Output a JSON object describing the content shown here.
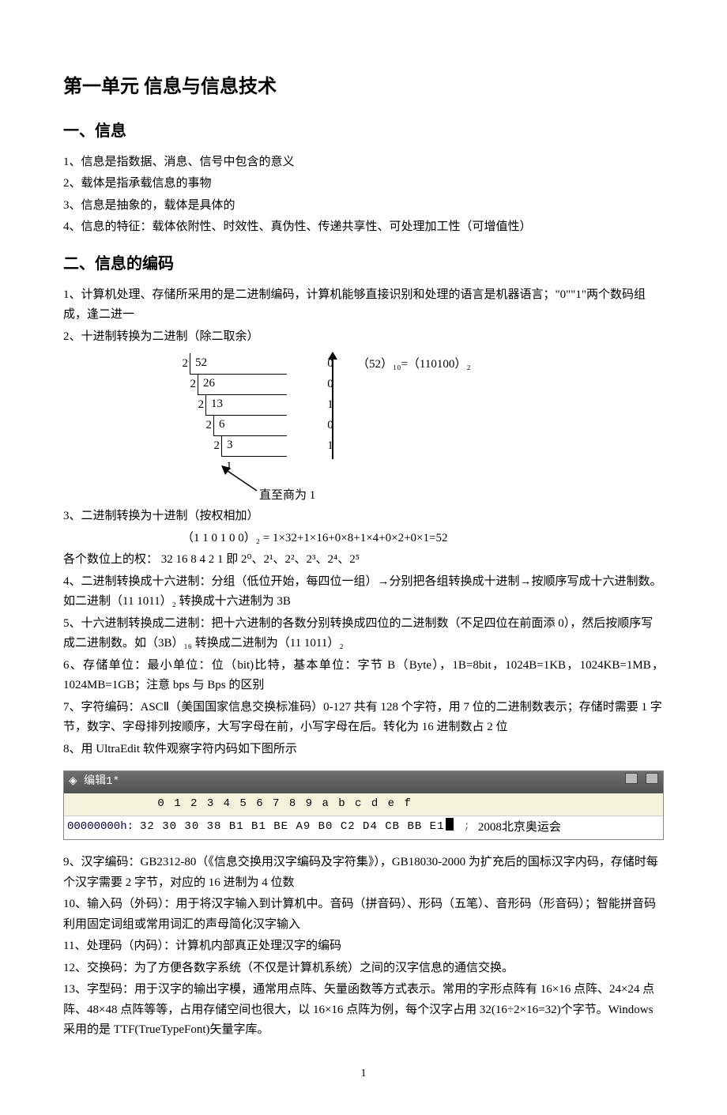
{
  "title": "第一单元 信息与信息技术",
  "sec1": {
    "heading": "一、信息",
    "p1": "1、信息是指数据、消息、信号中包含的意义",
    "p2": "2、载体是指承载信息的事物",
    "p3": "3、信息是抽象的，载体是具体的",
    "p4": "4、信息的特征：载体依附性、时效性、真伪性、传递共享性、可处理加工性（可增值性）"
  },
  "sec2": {
    "heading": "二、信息的编码",
    "p1": "1、计算机处理、存储所采用的是二进制编码，计算机能够直接识别和处理的语言是机器语言；\"0\"\"1\"两个数码组成，逢二进一",
    "p2": "2、十进制转换为二进制（除二取余）",
    "division": {
      "rows": [
        {
          "divisor": "2",
          "dividend": "52",
          "remainder": "0"
        },
        {
          "divisor": "2",
          "dividend": "26",
          "remainder": "0"
        },
        {
          "divisor": "2",
          "dividend": "13",
          "remainder": "1"
        },
        {
          "divisor": "2",
          "dividend": "6",
          "remainder": "0"
        },
        {
          "divisor": "2",
          "dividend": "3",
          "remainder": "1"
        }
      ],
      "final": "1",
      "note": "直至商为 1",
      "result": "（52）₁₀=（110100）₂"
    },
    "p3": "3、二进制转换为十进制（按权相加）",
    "eq": "（1   1    0   1   0   0）₂   =   1×32+1×16+0×8+1×4+0×2+0×1=52",
    "weights": "各个数位上的权：  32   16   8   4   2   1   即 2⁰、2¹、2²、2³、2⁴、2⁵",
    "p4": "4、二进制转换成十六进制：分组（低位开始，每四位一组）→分别把各组转换成十进制→按顺序写成十六进制数。如二进制（11 1011）₂ 转换成十六进制为 3B",
    "p5": "5、十六进制转换成二进制：把十六进制的各数分别转换成四位的二进制数（不足四位在前面添 0），然后按顺序写成二进制数。如（3B）₁₆ 转换成二进制为（11 1011）₂",
    "p6": "6、存储单位：最小单位：位（bit)比特，基本单位：字节 B（Byte），1B=8bit，1024B=1KB，1024KB=1MB，1024MB=1GB；注意 bps 与 Bps 的区别",
    "p7": "7、字符编码：ASCⅡ（美国国家信息交换标准码）0-127 共有 128 个字符，用 7 位的二进制数表示；存储时需要 1 字节，数字、字母排列按顺序，大写字母在前，小写字母在后。转化为 16 进制数占 2 位",
    "p8": "8、用 UltraEdit 软件观察字符内码如下图所示",
    "hex": {
      "title": "编辑1*",
      "ruler": "0  1  2  3  4  5  6  7  8  9  a  b  c  d  e  f",
      "offset": "00000000h:",
      "bytes": "32 30 30 38 B1 B1 BE A9 B0 C2 D4 CB BB E1",
      "sep": ";",
      "text": "2008北京奥运会"
    },
    "p9": "9、汉字编码：GB2312-80（《信息交换用汉字编码及字符集》），GB18030-2000 为扩充后的国标汉字内码，存储时每个汉字需要 2 字节，对应的 16 进制为 4 位数",
    "p10": "10、输入码（外码）：用于将汉字输入到计算机中。音码（拼音码）、形码（五笔）、音形码（形音码）；智能拼音码利用固定词组或常用词汇的声母简化汉字输入",
    "p11": "11、处理码（内码）：计算机内部真正处理汉字的编码",
    "p12": "12、交换码：为了方便各数字系统（不仅是计算机系统）之间的汉字信息的通信交换。",
    "p13": "13、字型码：用于汉字的输出字模，通常用点阵、矢量函数等方式表示。常用的字形点阵有 16×16 点阵、24×24 点阵、48×48 点阵等等，占用存储空间也很大，以 16×16 点阵为例，每个汉字占用 32(16÷2×16=32)个字节。Windows 采用的是 TTF(TrueTypeFont)矢量字库。"
  },
  "page_number": "1"
}
